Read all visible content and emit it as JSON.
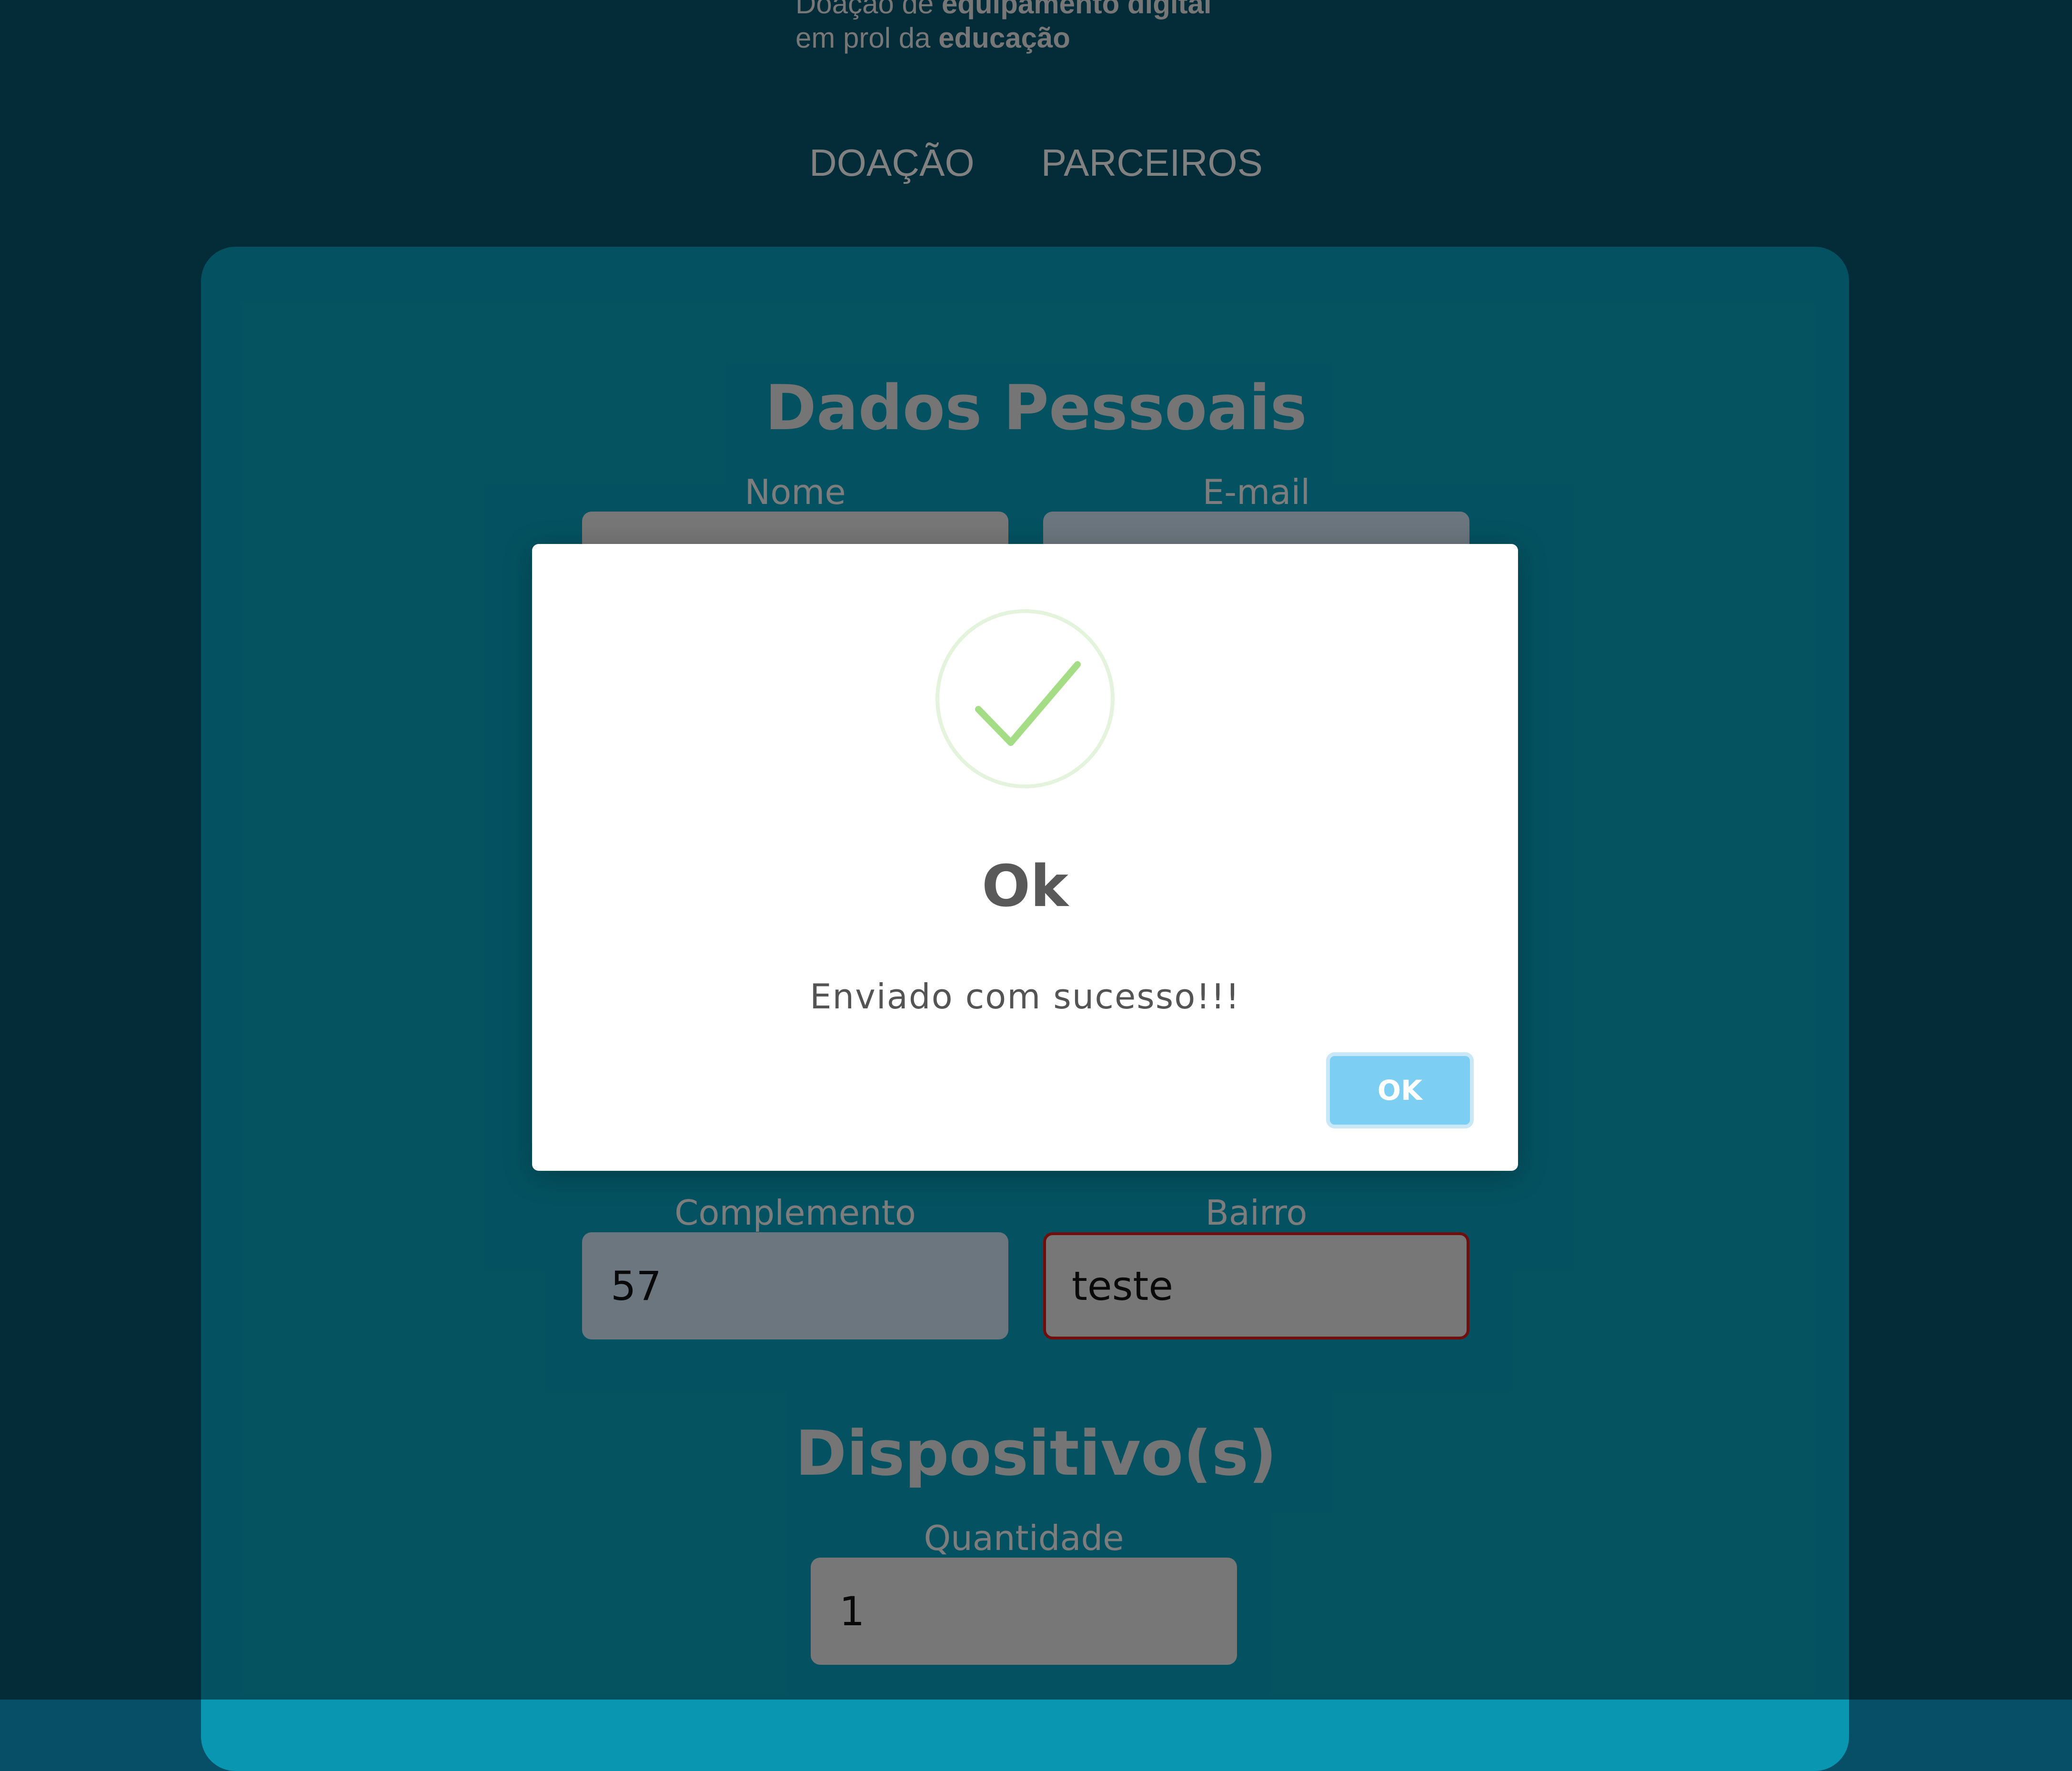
{
  "header": {
    "tagline_line1_prefix": "Doação de ",
    "tagline_line1_bold": "equipamento digital",
    "tagline_line2_prefix": "em prol da ",
    "tagline_line2_bold": "educação"
  },
  "nav": {
    "items": [
      {
        "label": "DOAÇÃO"
      },
      {
        "label": "PARCEIROS"
      }
    ]
  },
  "form": {
    "personal_title": "Dados Pessoais",
    "devices_title": "Dispositivo(s)",
    "fields": {
      "nome": {
        "label": "Nome",
        "value": ""
      },
      "email": {
        "label": "E-mail",
        "value": ""
      },
      "complemento": {
        "label": "Complemento",
        "value": "57"
      },
      "bairro": {
        "label": "Bairro",
        "value": "teste"
      },
      "quantidade": {
        "label": "Quantidade",
        "value": "1"
      }
    }
  },
  "modal": {
    "icon": "check-circle-icon",
    "title": "Ok",
    "message": "Enviado com sucesso!!!",
    "confirm_label": "OK"
  },
  "colors": {
    "page_background": "#064f66",
    "card_background": "#0996b1",
    "modal_background": "#ffffff",
    "success_green": "#a5dc86",
    "confirm_button": "#7ccff3",
    "invalid_border": "#cc1a1a"
  }
}
